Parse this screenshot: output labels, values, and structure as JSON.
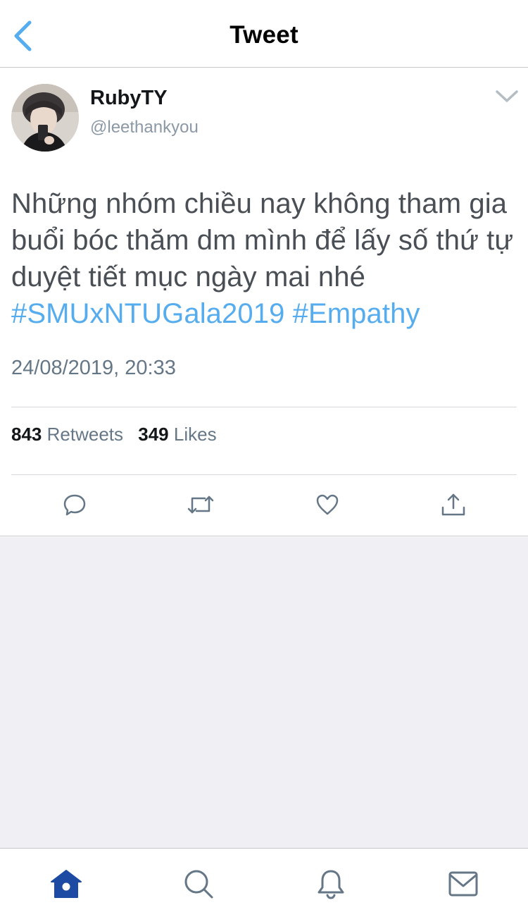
{
  "nav": {
    "title": "Tweet",
    "back_icon": "chevron-left-icon",
    "accent": "#55acee"
  },
  "tweet": {
    "author": {
      "display_name": "RubyTY",
      "handle": "@leethankyou"
    },
    "text": "Những nhóm chiều nay không tham gia buổi bóc thăm dm mình để lấy số thứ tự duyệt tiết mục ngày mai nhé",
    "hashtags": [
      "#SMUxNTUGala2019",
      "#Empathy"
    ],
    "timestamp": "24/08/2019, 20:33",
    "stats": {
      "retweets_count": "843",
      "retweets_label": "Retweets",
      "likes_count": "349",
      "likes_label": "Likes"
    },
    "actions": [
      "reply-icon",
      "retweet-icon",
      "heart-icon",
      "share-icon"
    ]
  },
  "tabbar": {
    "tabs": [
      "home-icon",
      "search-icon",
      "notifications-icon",
      "messages-icon"
    ],
    "active": "home",
    "active_color": "#1d4ba3"
  },
  "colors": {
    "hashtag": "#55acee",
    "body_text": "#4a4f55",
    "secondary_text": "#657786",
    "background": "#efeff4"
  }
}
